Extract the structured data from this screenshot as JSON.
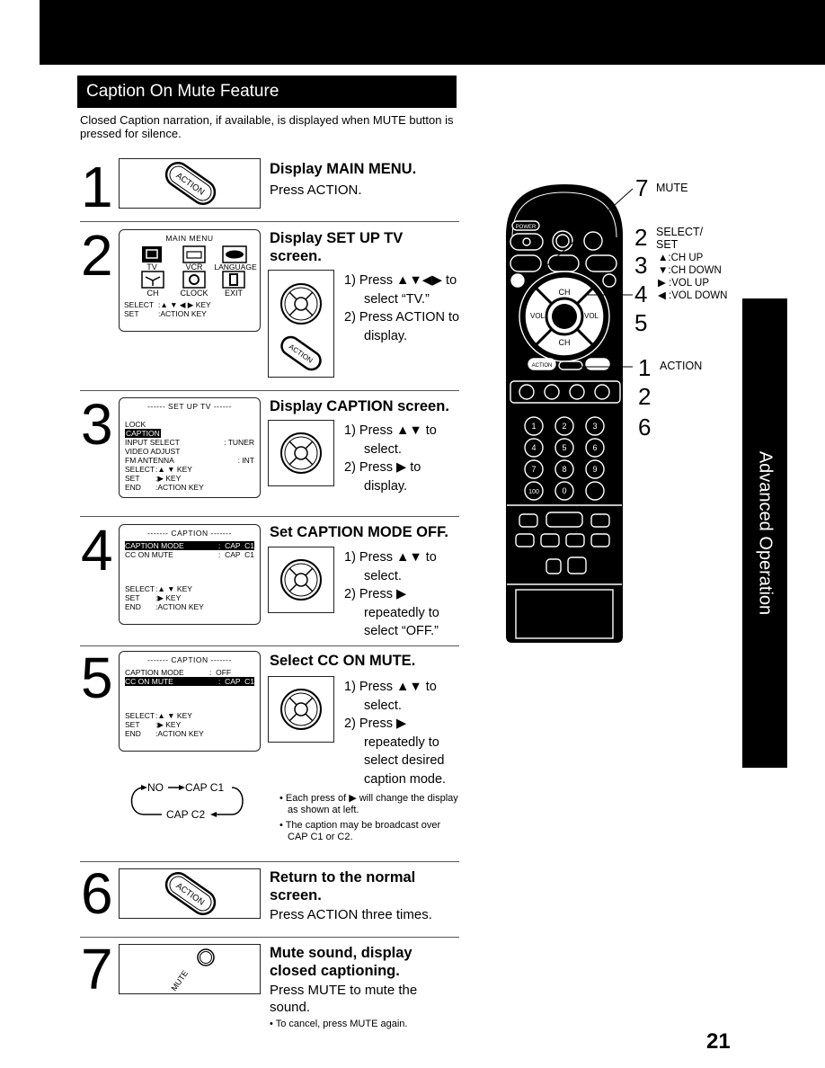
{
  "section_title": "Caption On Mute Feature",
  "intro": "Closed Caption narration, if available, is displayed when MUTE button is pressed for silence.",
  "steps": [
    {
      "number": "1",
      "heading": "Display MAIN MENU.",
      "body": "Press ACTION.",
      "illustration": "action-button"
    },
    {
      "number": "2",
      "heading": "Display SET UP TV screen.",
      "instructions": [
        "1) Press ▲▼◀▶ to select “TV.”",
        "2) Press ACTION to display."
      ],
      "osd": {
        "title": "MAIN MENU",
        "icons": [
          "TV",
          "VCR",
          "LANGUAGE",
          "CH",
          "CLOCK",
          "EXIT"
        ],
        "selected": "TV",
        "footer": [
          {
            "key": "SELECT",
            "value": ":▲ ▼ ◀ ▶ KEY"
          },
          {
            "key": "SET",
            "value": ":ACTION KEY"
          }
        ]
      }
    },
    {
      "number": "3",
      "heading": "Display CAPTION screen.",
      "instructions": [
        "1) Press ▲▼ to select.",
        "2) Press ▶ to display."
      ],
      "osd": {
        "title": "------ SET UP TV ------",
        "rows": [
          {
            "label": "LOCK",
            "value": ""
          },
          {
            "label": "CAPTION",
            "value": "",
            "highlighted": true
          },
          {
            "label": "INPUT SELECT",
            "value": ": TUNER"
          },
          {
            "label": "VIDEO ADJUST",
            "value": ""
          },
          {
            "label": "FM ANTENNA",
            "value": ": INT"
          }
        ],
        "footer": [
          {
            "key": "SELECT",
            "value": ":▲ ▼ KEY"
          },
          {
            "key": "SET",
            "value": ":▶ KEY"
          },
          {
            "key": "END",
            "value": ":ACTION KEY"
          }
        ]
      }
    },
    {
      "number": "4",
      "heading": "Set CAPTION MODE OFF.",
      "instructions": [
        "1) Press ▲▼ to select.",
        "2) Press ▶ repeatedly to select “OFF.”"
      ],
      "osd": {
        "title": "------- CAPTION -------",
        "rows": [
          {
            "label": "CAPTION MODE",
            "value": ":  CAP  C1",
            "highlighted": true
          },
          {
            "label": "CC ON MUTE",
            "value": ":  CAP  C1"
          }
        ],
        "footer": [
          {
            "key": "SELECT",
            "value": ":▲ ▼ KEY"
          },
          {
            "key": "SET",
            "value": ":▶ KEY"
          },
          {
            "key": "END",
            "value": ":ACTION KEY"
          }
        ]
      }
    },
    {
      "number": "5",
      "heading": "Select CC ON MUTE.",
      "instructions": [
        "1) Press ▲▼ to select.",
        "2) Press ▶ repeatedly to select desired caption mode."
      ],
      "osd": {
        "title": "------- CAPTION -------",
        "rows": [
          {
            "label": "CAPTION MODE",
            "value": ":  OFF"
          },
          {
            "label": "CC ON MUTE",
            "value": ":  CAP  C1",
            "highlighted": true
          }
        ],
        "footer": [
          {
            "key": "SELECT",
            "value": ":▲ ▼ KEY"
          },
          {
            "key": "SET",
            "value": ":▶ KEY"
          },
          {
            "key": "END",
            "value": ":ACTION KEY"
          }
        ]
      },
      "cycle": {
        "a": "NO",
        "b": "CAP C1",
        "c": "CAP C2"
      },
      "notes": [
        "• Each press of ▶ will change the display as shown at left.",
        "• The caption may be broadcast over CAP C1 or C2."
      ]
    },
    {
      "number": "6",
      "heading": "Return to the normal screen.",
      "body": "Press ACTION three times.",
      "illustration": "action-button"
    },
    {
      "number": "7",
      "heading": "Mute sound, display closed captioning.",
      "body": "Press MUTE to mute the sound.",
      "note": "• To cancel, press MUTE again.",
      "illustration": "mute-button"
    }
  ],
  "button_labels": {
    "action": "ACTION",
    "mute": "MUTE"
  },
  "remote": {
    "labels": {
      "mute": {
        "num": "7",
        "text": "MUTE"
      },
      "select": {
        "num": "2",
        "text1": "SELECT/",
        "text2": "SET"
      },
      "ch_up": {
        "num": "3",
        "text": "▲:CH UP"
      },
      "ch_down": {
        "text": "▼:CH DOWN"
      },
      "vol_up": {
        "num": "4",
        "text": "▶ :VOL UP"
      },
      "vol_down": {
        "text": "◀ :VOL DOWN"
      },
      "select_num5": "5",
      "action": {
        "num": "1",
        "text": "ACTION"
      },
      "action_num2": "2",
      "action_num6": "6"
    },
    "buttons": {
      "power": "POWER",
      "ch": "CH",
      "vol_minus": "VOL −",
      "vol_plus": "VOL +",
      "action": "ACTION",
      "keypad": [
        "1",
        "2",
        "3",
        "4",
        "5",
        "6",
        "7",
        "8",
        "9",
        "100",
        "0"
      ]
    }
  },
  "side_tab": "Advanced Operation",
  "page_number": "21"
}
